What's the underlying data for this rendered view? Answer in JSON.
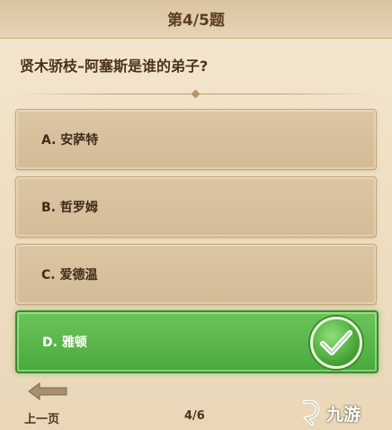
{
  "header": {
    "title": "第4/5题"
  },
  "question": {
    "text": "贤木骄枝–阿塞斯是谁的弟子?"
  },
  "options": [
    {
      "label": "A. 安萨特",
      "state": "normal"
    },
    {
      "label": "B. 哲罗姆",
      "state": "normal"
    },
    {
      "label": "C. 爱德温",
      "state": "normal"
    },
    {
      "label": "D. 雅顿",
      "state": "correct"
    }
  ],
  "footer": {
    "prev_label": "上一页",
    "page_indicator": "4/6"
  },
  "watermark": {
    "text": "九游"
  },
  "colors": {
    "correct": "#49a93c",
    "option_bg": "#d8c19c",
    "text_dark": "#4a3220"
  },
  "icons": {
    "check": "checkmark-icon",
    "back": "back-arrow-icon",
    "watermark_logo": "jiuyou-logo-icon"
  }
}
